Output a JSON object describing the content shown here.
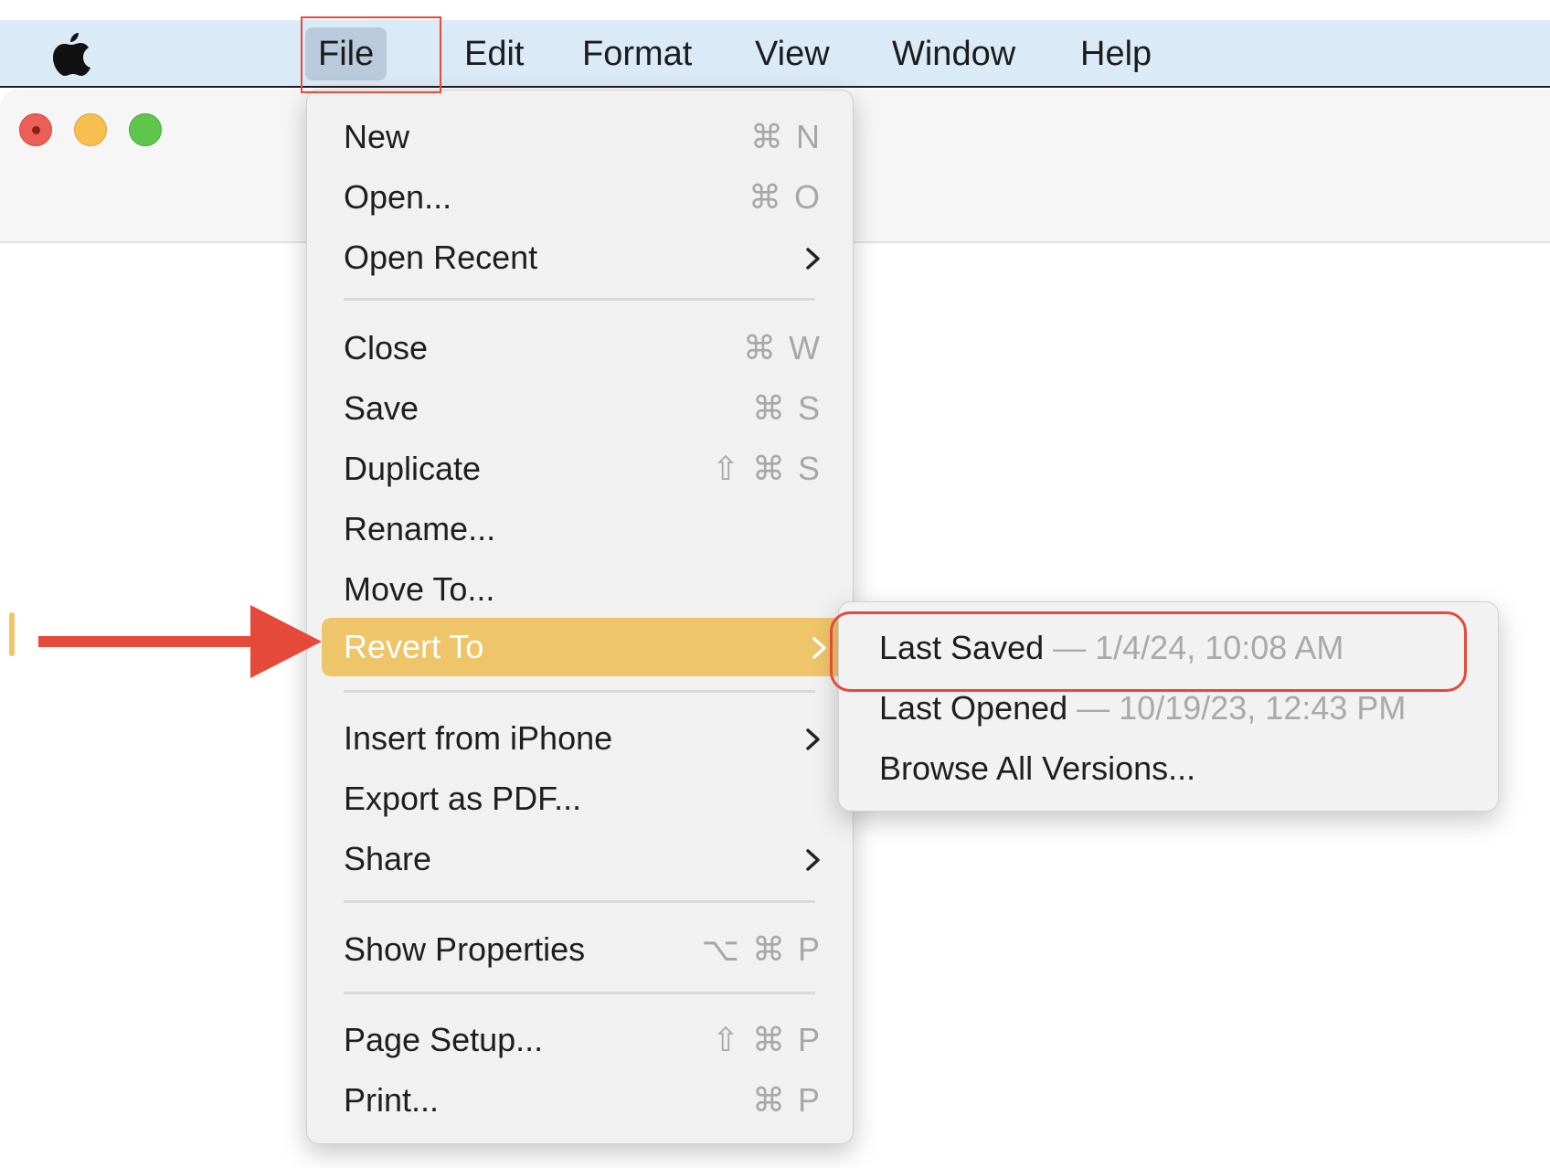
{
  "menubar": {
    "items": [
      {
        "label": "File"
      },
      {
        "label": "Edit"
      },
      {
        "label": "Format"
      },
      {
        "label": "View"
      },
      {
        "label": "Window"
      },
      {
        "label": "Help"
      }
    ]
  },
  "file_menu": {
    "new": {
      "label": "New",
      "shortcut": "⌘ N"
    },
    "open": {
      "label": "Open...",
      "shortcut": "⌘ O"
    },
    "open_recent": {
      "label": "Open Recent"
    },
    "close": {
      "label": "Close",
      "shortcut": "⌘ W"
    },
    "save": {
      "label": "Save",
      "shortcut": "⌘ S"
    },
    "duplicate": {
      "label": "Duplicate",
      "shortcut": "⇧ ⌘ S"
    },
    "rename": {
      "label": "Rename..."
    },
    "move_to": {
      "label": "Move To..."
    },
    "revert_to": {
      "label": "Revert To"
    },
    "insert_from_iphone": {
      "label": "Insert from iPhone"
    },
    "export_pdf": {
      "label": "Export as PDF..."
    },
    "share": {
      "label": "Share"
    },
    "show_properties": {
      "label": "Show Properties",
      "shortcut": "⌥ ⌘ P"
    },
    "page_setup": {
      "label": "Page Setup...",
      "shortcut": "⇧ ⌘ P"
    },
    "print": {
      "label": "Print...",
      "shortcut": "⌘ P"
    }
  },
  "revert_submenu": {
    "last_saved": {
      "label": "Last Saved",
      "date": " — 1/4/24, 10:08 AM"
    },
    "last_opened": {
      "label": "Last Opened",
      "date": " — 10/19/23, 12:43 PM"
    },
    "browse_all": {
      "label": "Browse All Versions..."
    }
  },
  "colors": {
    "menubar_bg": "#dbeaf7",
    "highlight": "#efc56a",
    "annotation_red": "#e5493a"
  },
  "icons": [
    "apple-logo-icon",
    "chevron-right-icon",
    "red-arrow-annotation"
  ]
}
